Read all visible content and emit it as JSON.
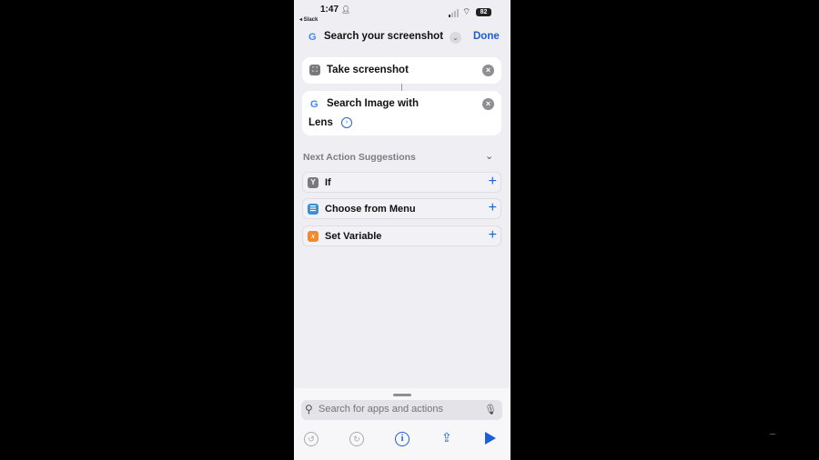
{
  "status_bar": {
    "time": "1:47",
    "back_app": "◂ Slack",
    "battery": "82"
  },
  "nav": {
    "title": "Search your screenshot",
    "done_label": "Done"
  },
  "actions": [
    {
      "label": "Take screenshot"
    },
    {
      "label_line1": "Search Image with",
      "label_line2": "Lens"
    }
  ],
  "suggestions": {
    "header": "Next Action Suggestions",
    "items": [
      {
        "label": "If",
        "icon": "if-icon",
        "color": "#7a7a7e"
      },
      {
        "label": "Choose from Menu",
        "icon": "menu-icon",
        "color": "#3a8fd4"
      },
      {
        "label": "Set Variable",
        "icon": "variable-icon",
        "color": "#f08a2c"
      }
    ]
  },
  "search": {
    "placeholder": "Search for apps and actions"
  },
  "toolbar": {
    "undo": "undo-icon",
    "redo": "redo-icon",
    "info": "info-icon",
    "share": "share-icon",
    "run": "play-icon"
  },
  "colors": {
    "accent": "#1a5fd8",
    "background": "#efeef3"
  }
}
